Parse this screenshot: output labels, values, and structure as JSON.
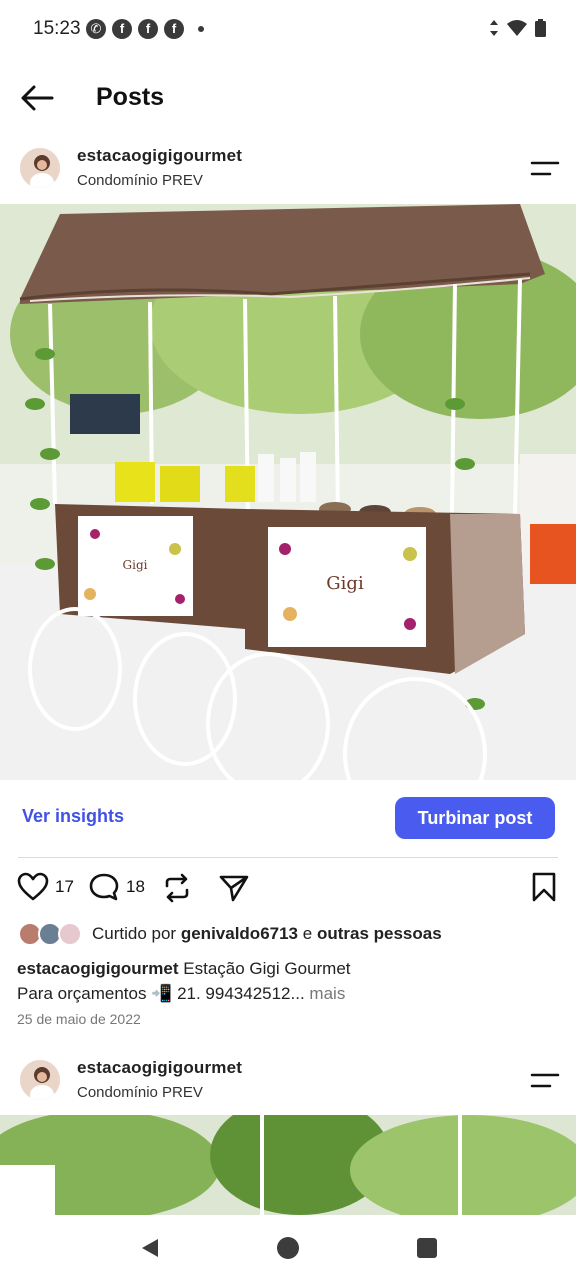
{
  "status_bar": {
    "time": "15:23",
    "notification_icons": [
      "whatsapp-icon",
      "facebook-icon",
      "facebook-icon",
      "facebook-icon",
      "dot-icon"
    ],
    "system_icons": [
      "data-arrows-icon",
      "wifi-icon",
      "battery-icon"
    ]
  },
  "header": {
    "title": "Posts"
  },
  "post": {
    "username": "estacaogigigourmet",
    "location": "Condomínio PREV",
    "image_alt": "Estação Gigi Gourmet",
    "insights_label": "Ver insights",
    "boost_label": "Turbinar post",
    "likes_count": "17",
    "comments_count": "18",
    "liked_by_prefix": "Curtido por",
    "liked_by_user": "genivaldo6713",
    "liked_by_conjunction": "e",
    "liked_by_others": "outras pessoas",
    "caption_user": "estacaogigigourmet",
    "caption_line1": "Estação Gigi Gourmet",
    "caption_line2": "Para orçamentos 📲 21. 994342512...",
    "more_label": "mais",
    "date": "25 de maio de 2022"
  },
  "next_post": {
    "username": "estacaogigigourmet",
    "location": "Condomínio PREV"
  },
  "colors": {
    "accent": "#4a5cf0",
    "link": "#4150e5",
    "cart_brown": "#6b4a3a"
  }
}
